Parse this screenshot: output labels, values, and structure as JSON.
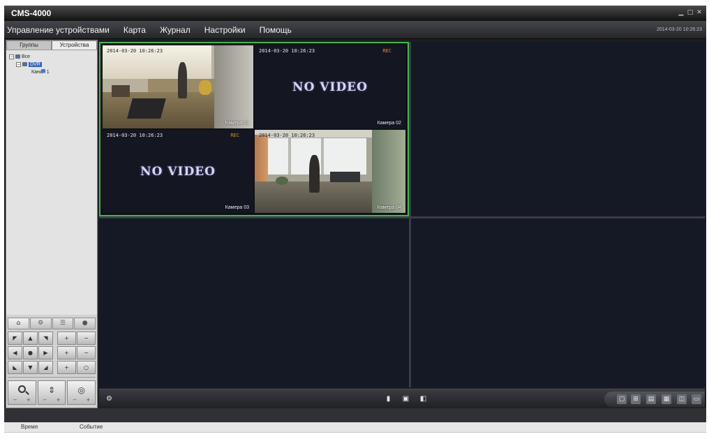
{
  "window": {
    "title": "CMS-4000",
    "controls": [
      "minimize-icon",
      "maximize-icon",
      "close-icon"
    ]
  },
  "menu": {
    "items": [
      "Управление устройствами",
      "Карта",
      "Журнал",
      "Настройки",
      "Помощь"
    ],
    "status": "2014-03-20 10:26:23"
  },
  "left_panel": {
    "tabs": [
      "Группы",
      "Устройства"
    ],
    "active_tab_index": 1,
    "tree": {
      "root": "Все",
      "device": "DVR",
      "channel": "Канал 1"
    },
    "ptz": {
      "tab_icons": [
        "ptz-icon",
        "settings-icon",
        "list-icon",
        "record-icon"
      ],
      "direction_icons": [
        "up-left-arrow-icon",
        "up-arrow-icon",
        "up-right-arrow-icon",
        "left-arrow-icon",
        "center-icon",
        "right-arrow-icon",
        "down-left-arrow-icon",
        "down-arrow-icon",
        "down-right-arrow-icon"
      ],
      "bottom_icons": [
        "zoom-icon",
        "focus-icon",
        "iris-icon"
      ]
    }
  },
  "video": {
    "layout": "4 windows, first split into 4",
    "tiles": [
      {
        "time": "2014-03-20 10:26:23",
        "name": "Камера 01"
      },
      {
        "time": "2014-03-20 10:26:23",
        "name": "Камера 02",
        "status": "NO VIDEO",
        "rec": "REC"
      },
      {
        "time": "2014-03-20 10:26:23",
        "name": "Камера 03",
        "status": "NO VIDEO",
        "rec": "REC"
      },
      {
        "time": "2014-03-20 10:26:23",
        "name": "Камера 04"
      }
    ]
  },
  "toolbar": {
    "left_icons": [
      "settings-icon"
    ],
    "center_icons": [
      "stop-all-icon",
      "snapshot-icon",
      "record-icon"
    ],
    "right_icons": [
      "layout-1-icon",
      "layout-4-icon",
      "layout-9-icon",
      "layout-16-icon",
      "fullscreen-icon",
      "sequence-icon"
    ]
  },
  "log": {
    "columns": [
      "Время",
      "Событие"
    ]
  },
  "colors": {
    "selected_window_border": "#3dbb4a",
    "tree_selection": "#2f63c4",
    "rec_text": "#e08a2a",
    "background": "#1c1e24"
  }
}
